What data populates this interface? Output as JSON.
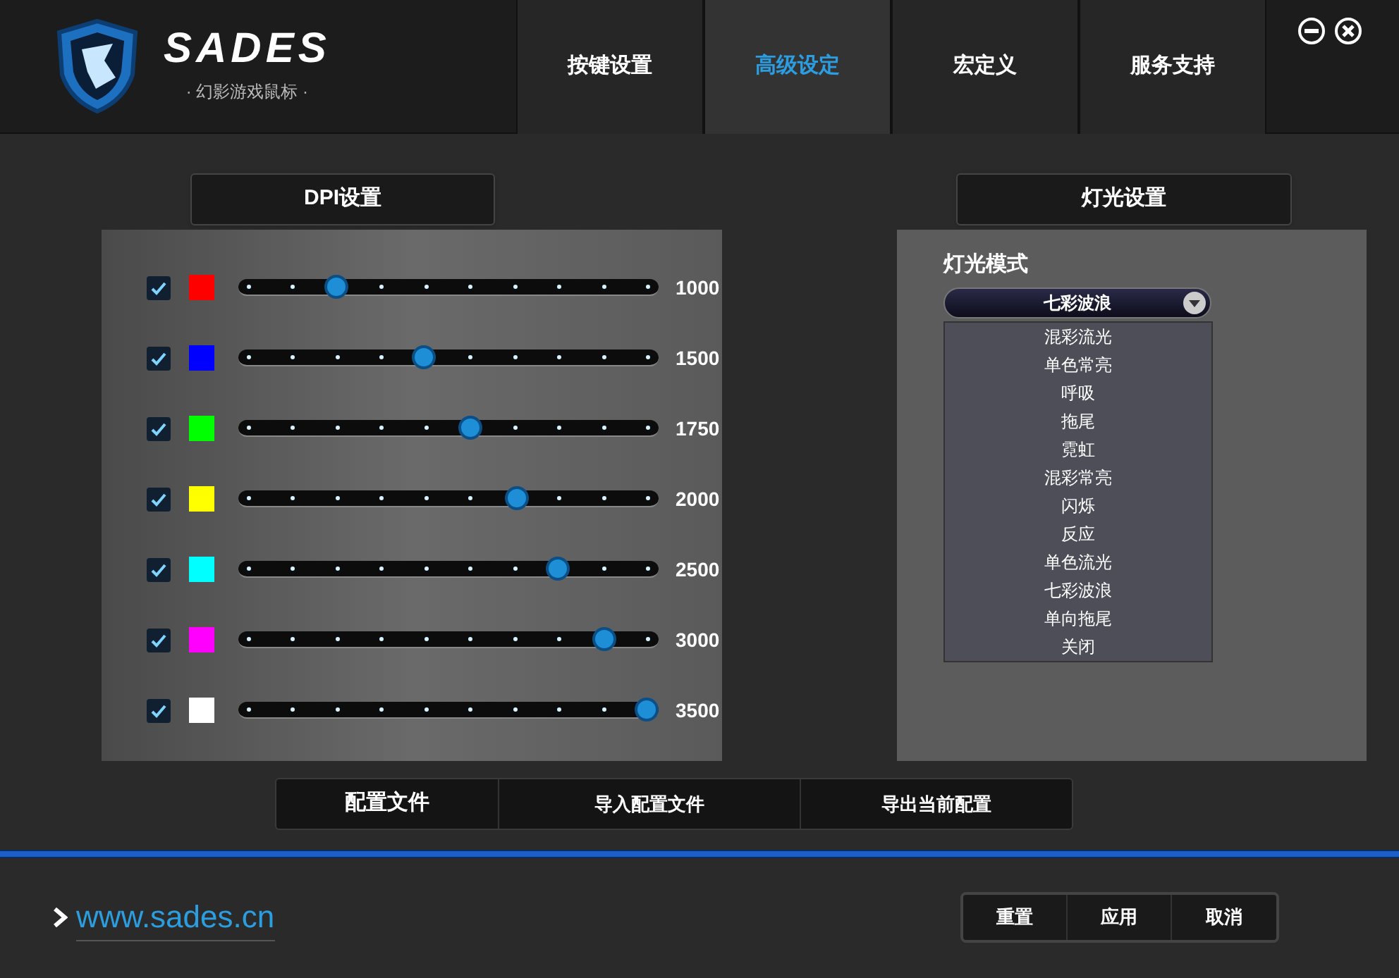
{
  "header": {
    "brand": "SADES",
    "tagline": "· 幻影游戏鼠标 ·"
  },
  "tabs": [
    {
      "label": "按键设置",
      "selected": false
    },
    {
      "label": "高级设定",
      "selected": true
    },
    {
      "label": "宏定义",
      "selected": false
    },
    {
      "label": "服务支持",
      "selected": false
    }
  ],
  "dpi": {
    "title": "DPI设置",
    "rows": [
      {
        "checked": true,
        "color": "#ff0000",
        "level": 0.23,
        "reading": "1000"
      },
      {
        "checked": true,
        "color": "#0000ff",
        "level": 0.44,
        "reading": "1500"
      },
      {
        "checked": true,
        "color": "#00ff00",
        "level": 0.55,
        "reading": "1750"
      },
      {
        "checked": true,
        "color": "#ffff00",
        "level": 0.66,
        "reading": "2000"
      },
      {
        "checked": true,
        "color": "#00ffff",
        "level": 0.76,
        "reading": "2500"
      },
      {
        "checked": true,
        "color": "#ff00ff",
        "level": 0.87,
        "reading": "3000"
      },
      {
        "checked": true,
        "color": "#ffffff",
        "level": 0.97,
        "reading": "3500"
      }
    ]
  },
  "lighting": {
    "title": "灯光设置",
    "mode_label": "灯光模式",
    "mode_value": "七彩波浪",
    "options": [
      "混彩流光",
      "单色常亮",
      "呼吸",
      "拖尾",
      "霓虹",
      "混彩常亮",
      "闪烁",
      "反应",
      "单色流光",
      "七彩波浪",
      "单向拖尾",
      "关闭"
    ]
  },
  "profile_bar": {
    "label": "配置文件",
    "buttons": [
      "导入配置文件",
      "导出当前配置"
    ]
  },
  "footer": {
    "link": "www.sades.cn",
    "buttons": [
      "重置",
      "应用",
      "取消"
    ]
  }
}
